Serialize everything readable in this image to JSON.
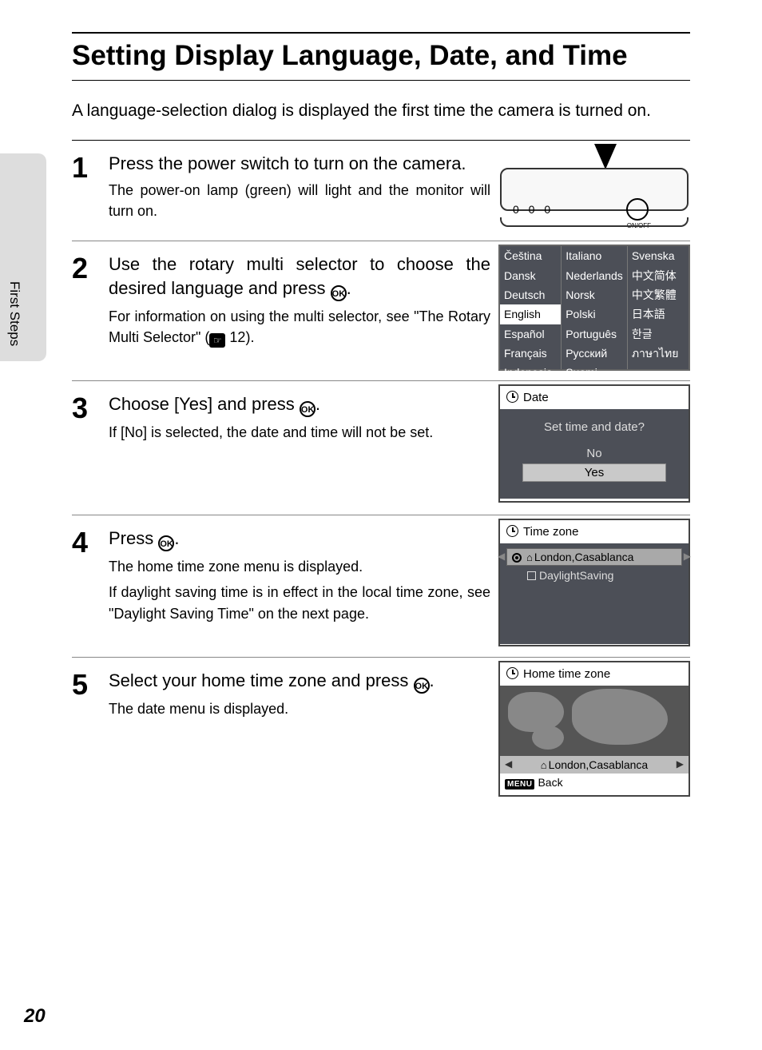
{
  "side_tab": "First Steps",
  "page_number": "20",
  "title": "Setting Display Language, Date, and Time",
  "intro": "A language-selection dialog is displayed the first time the camera is turned on.",
  "ok_glyph": "OK",
  "ref_glyph": "☞",
  "steps": [
    {
      "num": "1",
      "head": "Press the power switch to turn on the camera.",
      "desc": [
        "The power-on lamp (green) will light and the monitor will turn on."
      ]
    },
    {
      "num": "2",
      "head_pre": "Use the rotary multi selector to choose the desired language and press ",
      "head_post": ".",
      "desc_pre": "For information on using the multi selector, see \"The Rotary Multi Selector\" (",
      "desc_ref": " 12).",
      "languages": {
        "col1": [
          "Čeština",
          "Dansk",
          "Deutsch",
          "English",
          "Español",
          "Français",
          "Indonesia"
        ],
        "col2": [
          "Italiano",
          "Nederlands",
          "Norsk",
          "Polski",
          "Português",
          "Русский",
          "Suomi"
        ],
        "col3": [
          "Svenska",
          "中文简体",
          "中文繁體",
          "日本語",
          "한글",
          "ภาษาไทย",
          ""
        ]
      },
      "selected_language": "English"
    },
    {
      "num": "3",
      "head_pre": "Choose [Yes] and press ",
      "head_post": ".",
      "desc": [
        "If [No] is selected, the date and time will not be set."
      ],
      "dialog": {
        "title": "Date",
        "question": "Set time and date?",
        "opt_no": "No",
        "opt_yes": "Yes"
      }
    },
    {
      "num": "4",
      "head_pre": "Press ",
      "head_post": ".",
      "desc": [
        "The home time zone menu is displayed.",
        "If daylight saving time is in effect in the local time zone, see \"Daylight Saving Time\" on the next page."
      ],
      "dialog": {
        "title": "Time zone",
        "row1": "London,Casablanca",
        "row2": "DaylightSaving"
      }
    },
    {
      "num": "5",
      "head_pre": "Select your home time zone and press ",
      "head_post": ".",
      "desc": [
        "The date menu is displayed."
      ],
      "dialog": {
        "title": "Home time zone",
        "sel": "London,Casablanca",
        "menu_tag": "MENU",
        "back": "Back"
      }
    }
  ]
}
